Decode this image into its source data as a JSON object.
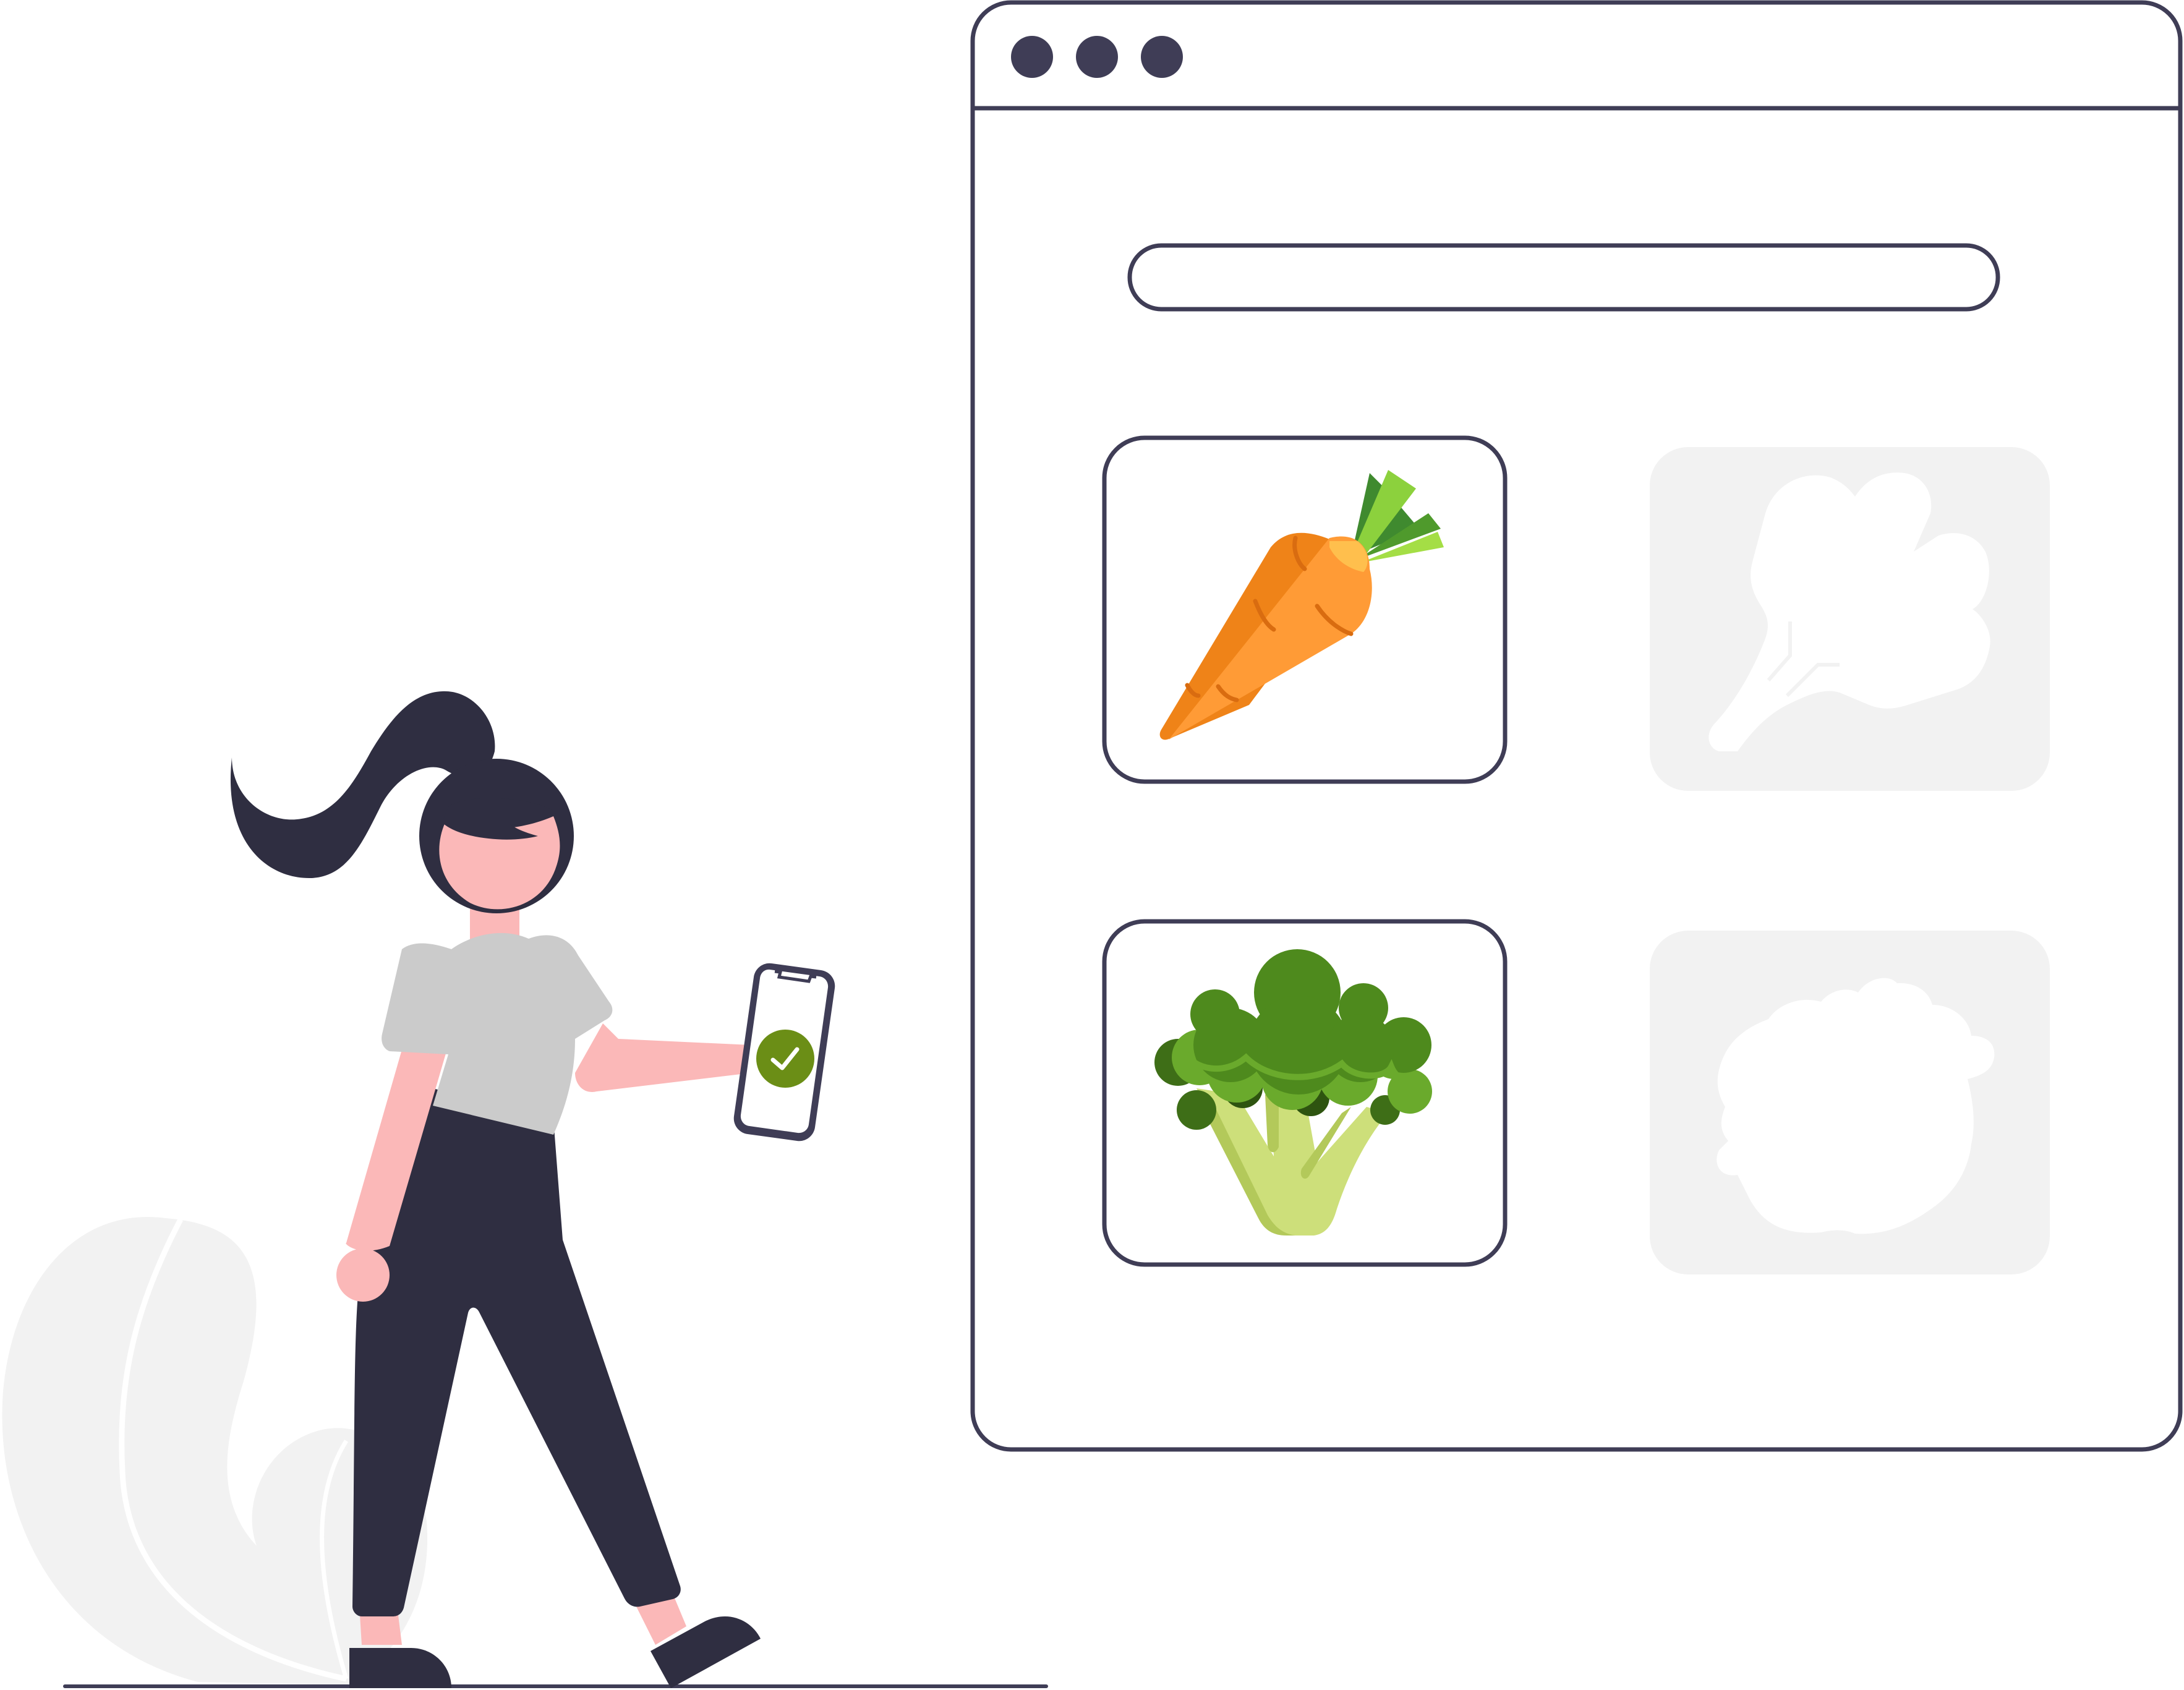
{
  "illustration": {
    "subject": "person-holding-phone-next-to-browser-grid",
    "colors": {
      "outline": "#3f3d56",
      "dark": "#2f2e41",
      "skin": "#fbb8b8",
      "shirt": "#cbcbcb",
      "placeholder": "#f2f2f2",
      "check": "#6b8e16",
      "carrot_dark": "#ef8318",
      "carrot_light": "#ff9b36",
      "leaf_dark": "#3f8a2f",
      "leaf_light": "#8cd13d",
      "broccoli_dark": "#4e8a1d",
      "broccoli_mid": "#6aaa2c",
      "broccoli_stem": "#cddf7a"
    }
  },
  "browser": {
    "window_controls": [
      "dot-icon",
      "dot-icon",
      "dot-icon"
    ],
    "search_bar": {
      "placeholder": ""
    },
    "cards": [
      {
        "icon": "carrot-icon",
        "state": "selected"
      },
      {
        "icon": "leafy-vegetable-icon",
        "state": "placeholder"
      },
      {
        "icon": "broccoli-icon",
        "state": "selected"
      },
      {
        "icon": "cauliflower-icon",
        "state": "placeholder"
      }
    ]
  },
  "phone": {
    "status_icon": "check-circle-icon"
  }
}
